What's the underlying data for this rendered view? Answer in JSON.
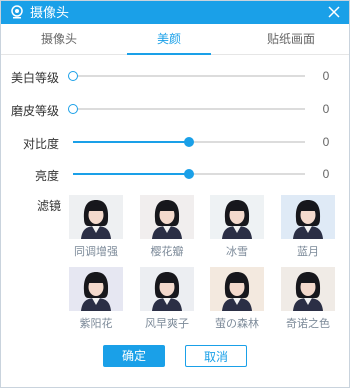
{
  "window": {
    "title": "摄像头",
    "app_icon": "webcam-icon",
    "close_icon": "close-icon",
    "accent_color": "#1aa0e8"
  },
  "tabs": [
    {
      "label": "摄像头",
      "active": false
    },
    {
      "label": "美颜",
      "active": true
    },
    {
      "label": "贴纸画面",
      "active": false
    }
  ],
  "sliders": [
    {
      "label": "美白等级",
      "value": "0",
      "fraction": 0.0
    },
    {
      "label": "磨皮等级",
      "value": "0",
      "fraction": 0.0
    },
    {
      "label": "对比度",
      "value": "0",
      "fraction": 0.5
    },
    {
      "label": "亮度",
      "value": "0",
      "fraction": 0.5
    }
  ],
  "filters": {
    "label": "滤镜",
    "items": [
      {
        "name": "同调增强",
        "tint": "#eef0f2"
      },
      {
        "name": "樱花瓣",
        "tint": "#f1eeee"
      },
      {
        "name": "冰雪",
        "tint": "#eef2f4"
      },
      {
        "name": "蓝月",
        "tint": "#dfeaf6"
      },
      {
        "name": "紫阳花",
        "tint": "#e6e7f2"
      },
      {
        "name": "风早爽子",
        "tint": "#eceef2"
      },
      {
        "name": "萤の森林",
        "tint": "#f3e9df"
      },
      {
        "name": "奇诺之色",
        "tint": "#f0ebe6"
      }
    ]
  },
  "buttons": {
    "ok_label": "确定",
    "cancel_label": "取消"
  }
}
